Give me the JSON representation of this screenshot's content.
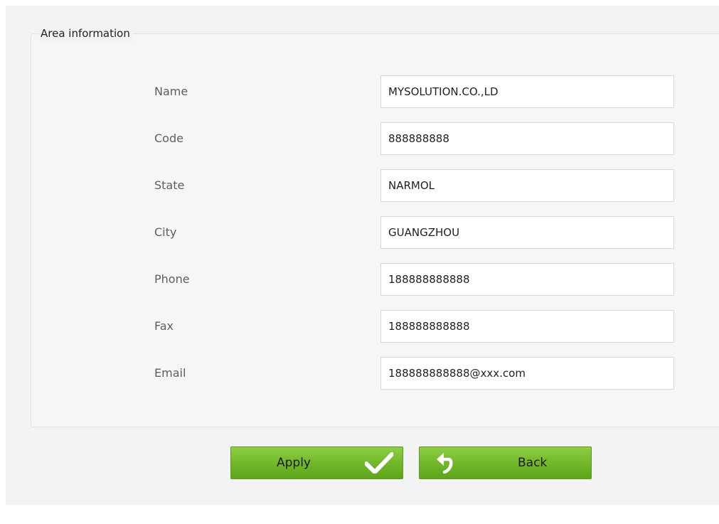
{
  "form": {
    "legend": "Area information",
    "fields": [
      {
        "label": "Name",
        "value": "MYSOLUTION.CO.,LD"
      },
      {
        "label": "Code",
        "value": "888888888"
      },
      {
        "label": "State",
        "value": "NARMOL"
      },
      {
        "label": "City",
        "value": "GUANGZHOU"
      },
      {
        "label": "Phone",
        "value": "188888888888"
      },
      {
        "label": "Fax",
        "value": "188888888888"
      },
      {
        "label": "Email",
        "value": "188888888888@xxx.com"
      }
    ]
  },
  "buttons": {
    "apply_label": "Apply",
    "back_label": "Back"
  },
  "icons": {
    "apply": "checkmark-icon",
    "back": "undo-arrow-icon"
  },
  "colors": {
    "button_green": "#72b82a",
    "panel_bg": "#f3f3f3"
  }
}
